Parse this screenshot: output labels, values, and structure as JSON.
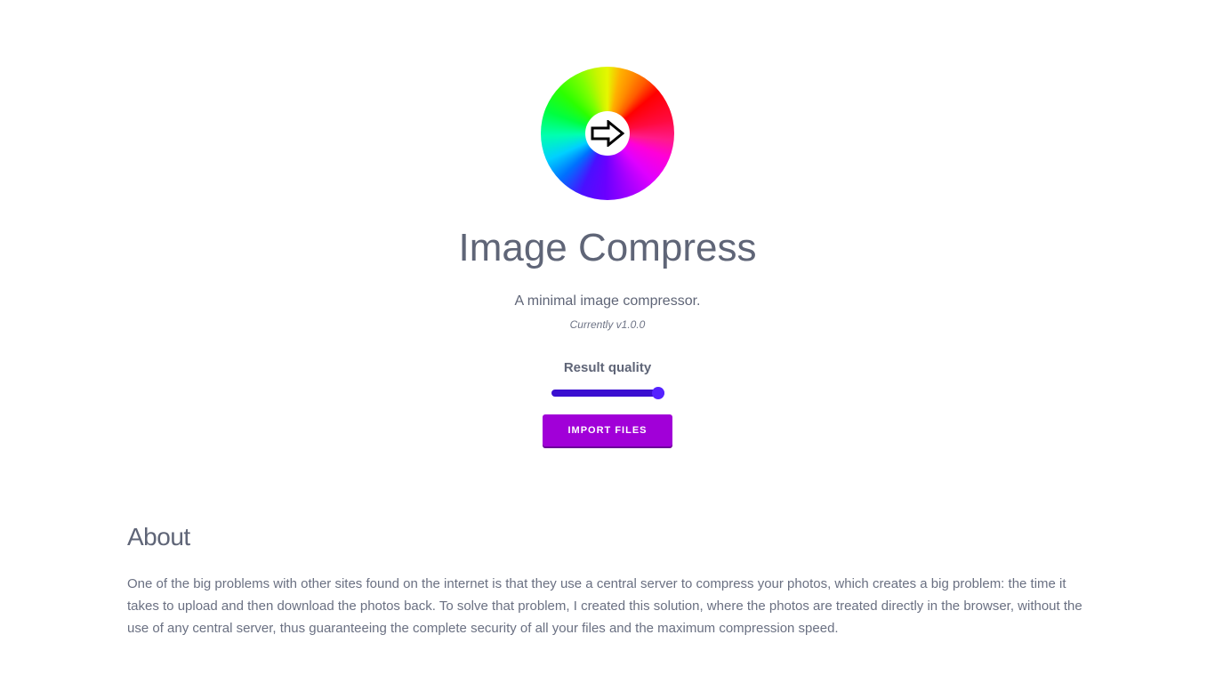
{
  "header": {
    "logo_icon": "arrow-right-icon",
    "title": "Image Compress",
    "subtitle": "A minimal image compressor.",
    "version": "Currently v1.0.0"
  },
  "controls": {
    "quality_label": "Result quality",
    "quality_value": 1.0,
    "import_button_label": "IMPORT FILES",
    "colors": {
      "slider_track": "#3a0fd0",
      "slider_thumb": "#5522ff",
      "button_bg": "#a100d8"
    }
  },
  "about": {
    "heading": "About",
    "text": "One of the big problems with other sites found on the internet is that they use a central server to compress your photos, which creates a big problem: the time it takes to upload and then download the photos back. To solve that problem, I created this solution, where the photos are treated directly in the browser, without the use of any central server, thus guaranteeing the complete security of all your files and the maximum compression speed."
  }
}
